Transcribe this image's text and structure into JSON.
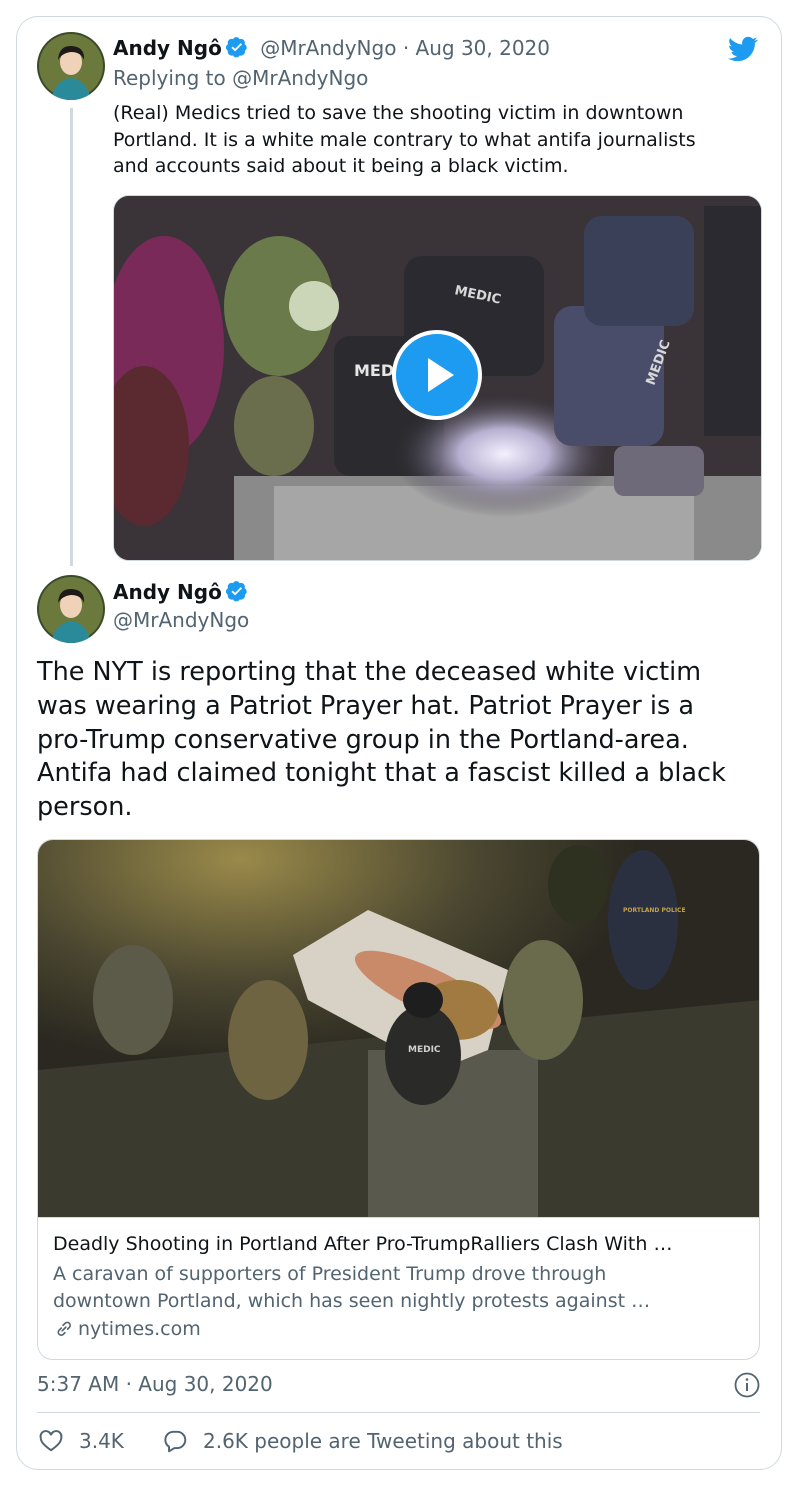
{
  "reply_tweet": {
    "author_name": "Andy Ngô",
    "handle": "@MrAndyNgo",
    "separator": "·",
    "date": "Aug 30, 2020",
    "replying_to_prefix": "Replying to",
    "replying_to_handle": "@MrAndyNgo",
    "text_lines": [
      "(Real) Medics tried to save the shooting victim in downtown",
      "Portland. It is a white male contrary to what antifa journalists",
      "and accounts said about it being a black victim."
    ],
    "video_labels": [
      "MEDI",
      "MEDIC",
      "MEDIC"
    ]
  },
  "main_tweet": {
    "author_name": "Andy Ngô",
    "handle": "@MrAndyNgo",
    "text_lines": [
      "The NYT is reporting that the deceased white victim",
      "was wearing a Patriot Prayer hat. Patriot Prayer is a",
      "pro-Trump conservative group in the Portland-area.",
      "Antifa had claimed tonight that a fascist killed a black",
      "person."
    ],
    "link_card": {
      "title": "Deadly Shooting in Portland After Pro-TrumpRalliers Clash With …",
      "description_lines": [
        "A caravan of supporters of President Trump drove through",
        "downtown Portland, which has seen nightly protests against …"
      ],
      "domain": "nytimes.com",
      "photo_labels": [
        "MEDIC",
        "PORTLAND POLICE"
      ]
    },
    "timestamp": "5:37 AM · Aug 30, 2020",
    "likes": "3.4K",
    "retweet_text": "2.6K people are Tweeting about this"
  },
  "icons": {
    "bird": "twitter-bird-icon",
    "verified": "verified-badge-icon",
    "play": "play-icon",
    "link": "link-icon",
    "info": "info-icon",
    "heart": "heart-icon",
    "comment": "comment-icon"
  },
  "colors": {
    "brand_blue": "#1d9bf0",
    "text": "#0f1419",
    "muted": "#536471",
    "border": "#cfd9de"
  }
}
